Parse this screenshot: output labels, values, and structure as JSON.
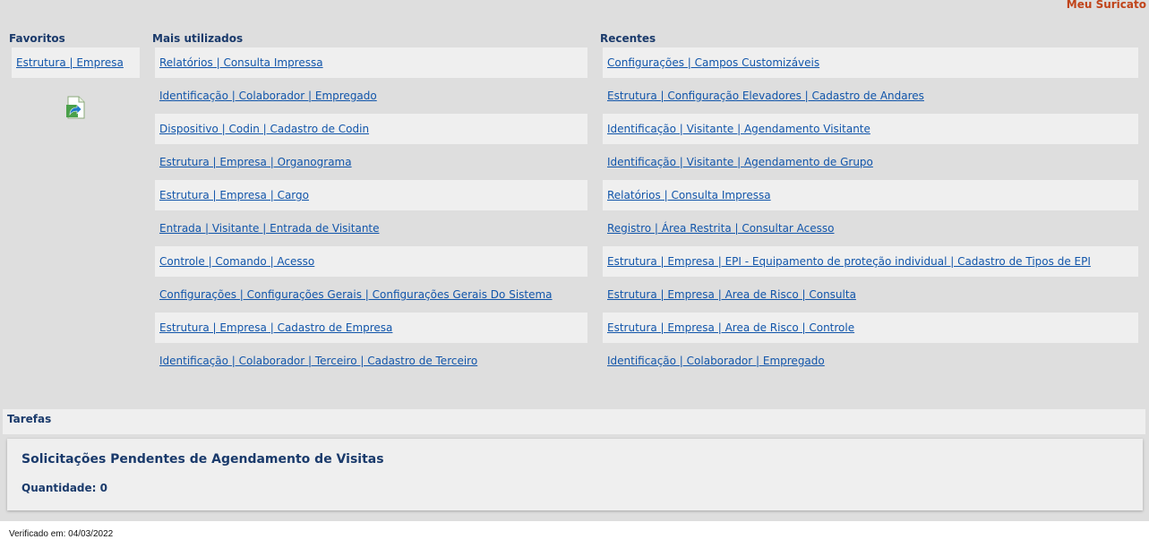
{
  "brand": {
    "label": "Meu Suricato"
  },
  "favorites": {
    "title": "Favoritos",
    "items": [
      "Estrutura | Empresa"
    ],
    "export_icon": "export-arrow-icon"
  },
  "most_used": {
    "title": "Mais utilizados",
    "items": [
      "Relatórios | Consulta Impressa",
      "Identificação | Colaborador | Empregado",
      "Dispositivo | Codin | Cadastro de Codin",
      "Estrutura | Empresa | Organograma",
      "Estrutura | Empresa | Cargo",
      "Entrada | Visitante | Entrada de Visitante",
      "Controle | Comando | Acesso",
      "Configurações | Configurações Gerais | Configurações Gerais Do Sistema",
      "Estrutura | Empresa | Cadastro de Empresa",
      "Identificação | Colaborador | Terceiro | Cadastro de Terceiro"
    ]
  },
  "recent": {
    "title": "Recentes",
    "items": [
      "Configurações | Campos Customizáveis",
      "Estrutura | Configuração Elevadores | Cadastro de Andares",
      "Identificação | Visitante | Agendamento Visitante",
      "Identificação | Visitante | Agendamento de Grupo",
      "Relatórios | Consulta Impressa",
      "Registro | Área Restrita | Consultar Acesso",
      "Estrutura | Empresa | EPI - Equipamento de proteção individual | Cadastro de Tipos de EPI",
      "Estrutura | Empresa | Area de Risco | Consulta",
      "Estrutura | Empresa | Area de Risco | Controle",
      "Identificação | Colaborador | Empregado"
    ]
  },
  "tasks": {
    "title": "Tarefas",
    "heading": "Solicitações Pendentes de Agendamento de Visitas",
    "count_label": "Quantidade: 0"
  },
  "footer": {
    "text": "Verificado em: 04/03/2022"
  },
  "colors": {
    "background": "#dedede",
    "panel": "#efefef",
    "link": "#1155aa",
    "heading": "#1a3a6b",
    "brand": "#c0441a"
  }
}
